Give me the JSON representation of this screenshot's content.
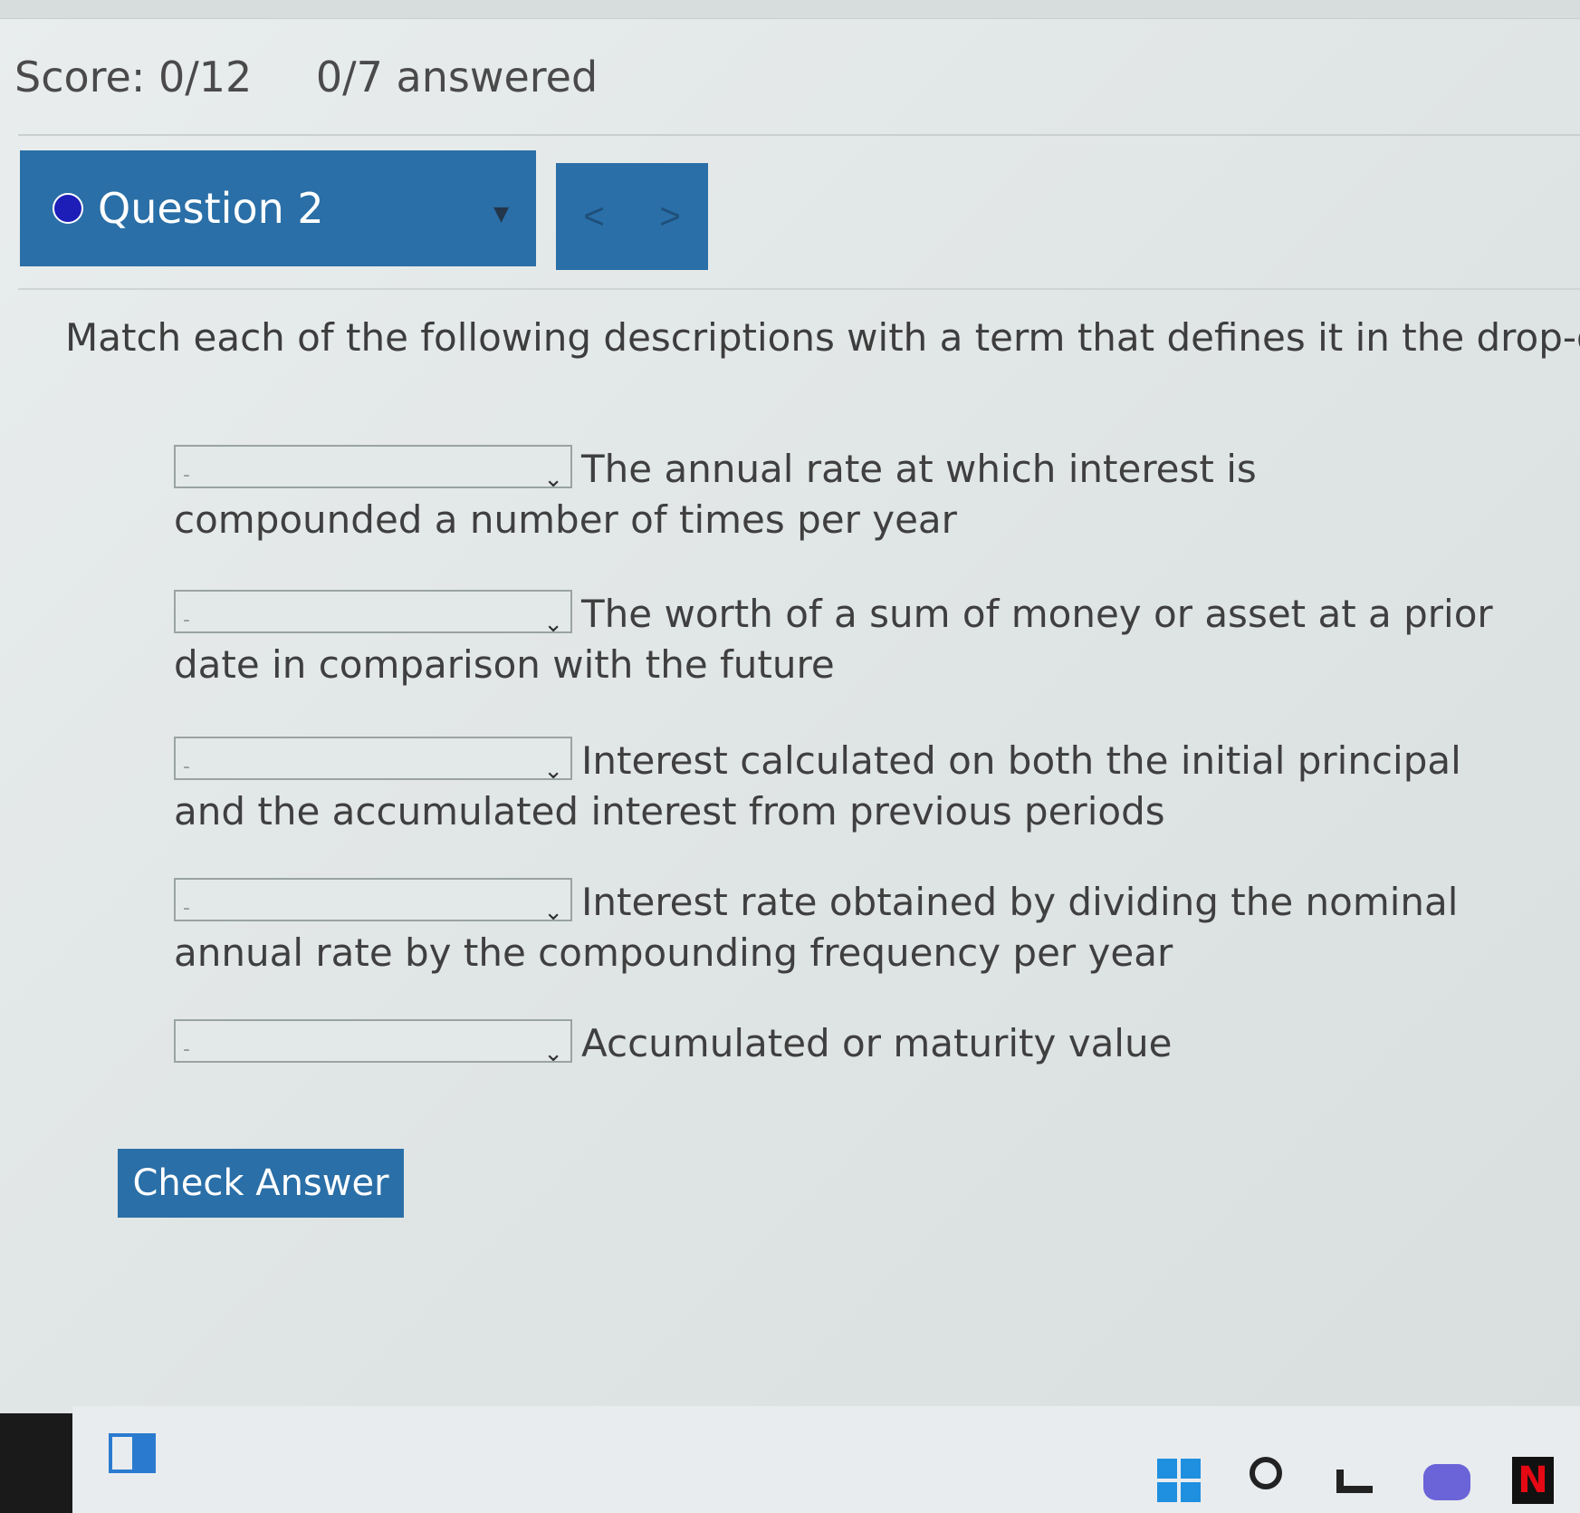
{
  "score": {
    "score_text": "Score: 0/12",
    "answered_text": "0/7 answered"
  },
  "question": {
    "title": "Question 2"
  },
  "nav": {
    "prev": "<",
    "next": ">"
  },
  "instruction": "Match each of the following descriptions with a term that defines it in the drop-down.",
  "items": [
    {
      "selected": "-",
      "text": "The annual rate at which interest is compounded a number of times per year"
    },
    {
      "selected": "-",
      "text": "The worth of a sum of money or asset at a prior date in comparison with the future"
    },
    {
      "selected": "-",
      "text": "Interest calculated on both the initial principal and the accumulated interest from previous periods"
    },
    {
      "selected": "-",
      "text": "Interest rate obtained by dividing the nominal annual rate by the compounding frequency per year"
    },
    {
      "selected": "-",
      "text": "Accumulated or maturity value"
    }
  ],
  "check_button": "Check Answer",
  "taskbar": {
    "icons": [
      "widgets-icon",
      "windows-start-icon",
      "search-icon",
      "file-explorer-icon",
      "chat-icon",
      "netflix-icon"
    ],
    "netflix_letter": "N"
  },
  "colors": {
    "accent": "#2a6fa7",
    "dot": "#1d1db8"
  }
}
